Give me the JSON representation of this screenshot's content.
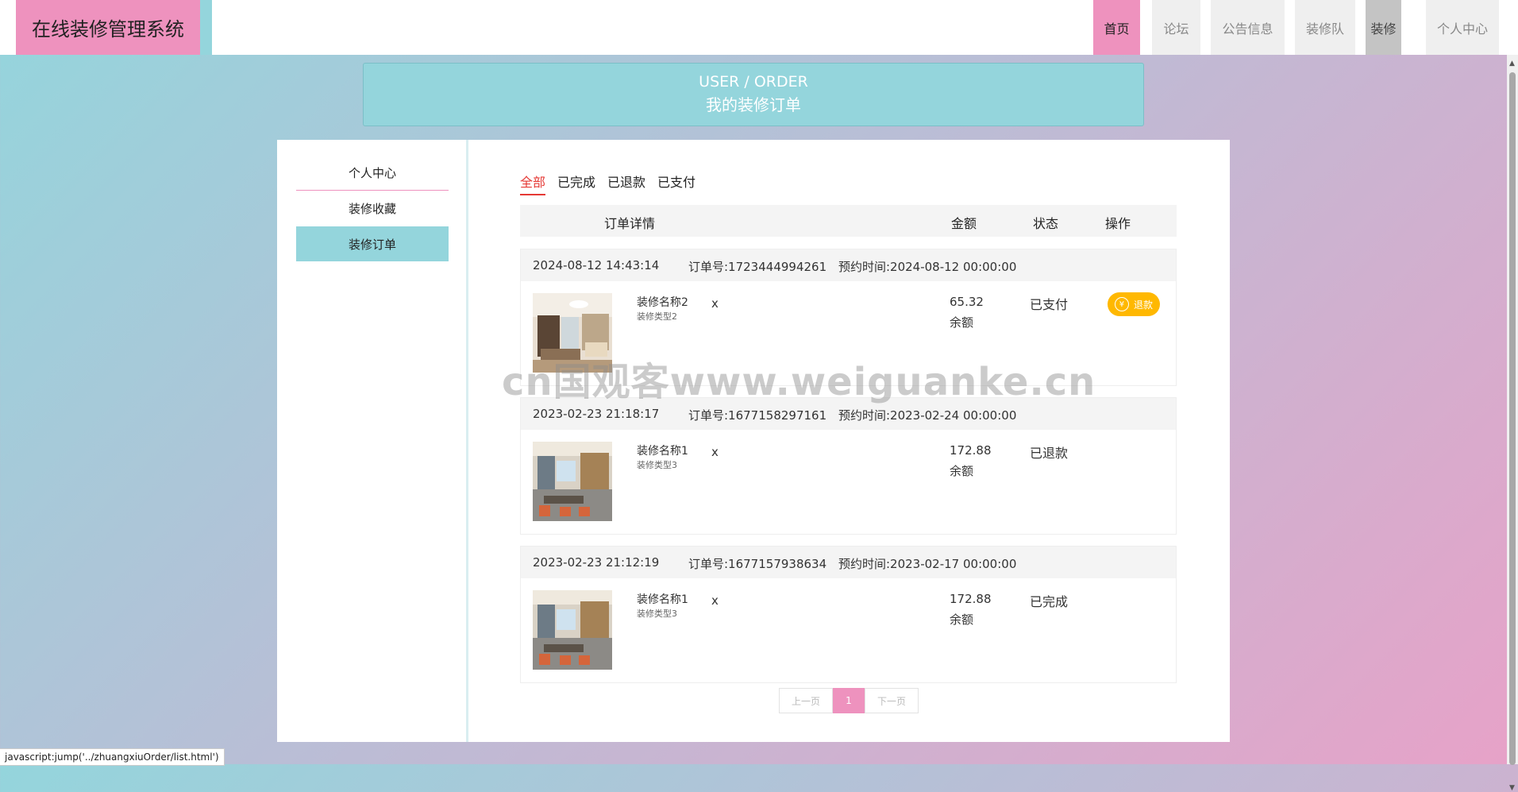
{
  "header": {
    "brand": "在线装修管理系统",
    "nav": [
      {
        "label": "首页",
        "state": "active"
      },
      {
        "label": "论坛",
        "state": ""
      },
      {
        "label": "公告信息",
        "state": ""
      },
      {
        "label": "装修队",
        "state": ""
      },
      {
        "label": "装修",
        "state": "dark"
      },
      {
        "label": "个人中心",
        "state": ""
      }
    ]
  },
  "banner": {
    "en": "USER / ORDER",
    "cn": "我的装修订单"
  },
  "sidebar": {
    "items": [
      "个人中心",
      "装修收藏",
      "装修订单"
    ],
    "active_index": 2
  },
  "tabs": {
    "items": [
      "全部",
      "已完成",
      "已退款",
      "已支付"
    ],
    "active_index": 0
  },
  "table_header": {
    "detail": "订单详情",
    "amount": "金额",
    "status": "状态",
    "action": "操作"
  },
  "orders": [
    {
      "created": "2024-08-12 14:43:14",
      "order_no": "订单号:1723444994261",
      "reserve": "预约时间:2024-08-12 00:00:00",
      "name": "装修名称2",
      "type": "装修类型2",
      "x": "x",
      "amount": "65.32",
      "balance": "余额",
      "status": "已支付",
      "refund_label": "退款",
      "has_refund": true
    },
    {
      "created": "2023-02-23 21:18:17",
      "order_no": "订单号:1677158297161",
      "reserve": "预约时间:2023-02-24 00:00:00",
      "name": "装修名称1",
      "type": "装修类型3",
      "x": "x",
      "amount": "172.88",
      "balance": "余额",
      "status": "已退款",
      "has_refund": false
    },
    {
      "created": "2023-02-23 21:12:19",
      "order_no": "订单号:1677157938634",
      "reserve": "预约时间:2023-02-17 00:00:00",
      "name": "装修名称1",
      "type": "装修类型3",
      "x": "x",
      "amount": "172.88",
      "balance": "余额",
      "status": "已完成",
      "has_refund": false
    }
  ],
  "pager": {
    "prev": "上一页",
    "current": "1",
    "next": "下一页"
  },
  "watermark": "cn国观客www.weiguanke.cn",
  "status_bar": "javascript:jump('../zhuangxiuOrder/list.html')",
  "colors": {
    "accent_pink": "#ee92be",
    "accent_teal": "#94d5dc",
    "refund_yellow": "#ffb800",
    "tab_active_red": "#e53935"
  }
}
